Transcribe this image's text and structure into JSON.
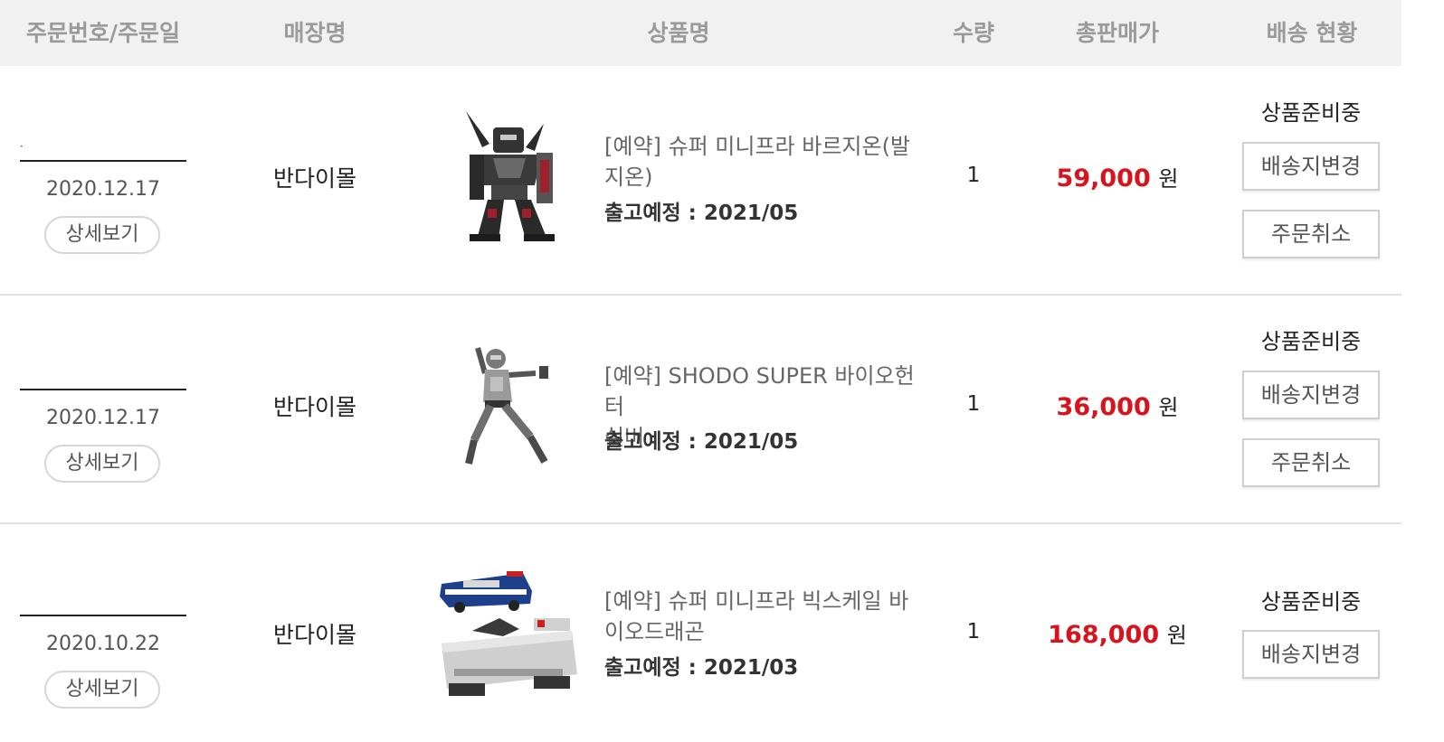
{
  "header": {
    "col_order": "주문번호/주문일",
    "col_store": "매장명",
    "col_product": "상품명",
    "col_qty": "수량",
    "col_total": "총판매가",
    "col_status": "배송 현황"
  },
  "orders": [
    {
      "order_number": "·",
      "date": "2020.12.17",
      "detail_label": "상세보기",
      "store": "반다이몰",
      "product_image": "robot-figure-dark",
      "product_name_line1": "[예약] 슈퍼 미니프라 바르지온(발",
      "product_name_line2": "지온)",
      "release": "출고예정 : 2021/05",
      "qty": "1",
      "price": "59,000",
      "currency": "원",
      "status": "상품준비중",
      "btn_change_address": "배송지변경",
      "btn_cancel": "주문취소"
    },
    {
      "order_number": "",
      "date": "2020.12.17",
      "detail_label": "상세보기",
      "store": "반다이몰",
      "product_image": "hero-figure-silver",
      "product_name_line1": "[예약] SHODO SUPER 바이오헌터",
      "product_name_line2": "실버",
      "release": "출고예정 : 2021/05",
      "qty": "1",
      "price": "36,000",
      "currency": "원",
      "status": "상품준비중",
      "btn_change_address": "배송지변경",
      "btn_cancel": "주문취소"
    },
    {
      "order_number": "",
      "date": "2020.10.22",
      "detail_label": "상세보기",
      "store": "반다이몰",
      "product_image": "vehicle-model-set",
      "product_name_line1": "[예약] 슈퍼 미니프라 빅스케일 바",
      "product_name_line2": "이오드래곤",
      "release": "출고예정 : 2021/03",
      "qty": "1",
      "price": "168,000",
      "currency": "원",
      "status": "상품준비중",
      "btn_change_address": "배송지변경"
    }
  ],
  "colors": {
    "header_bg": "#f1f1f1",
    "header_text": "#9a9a9a",
    "price_red": "#d7141c",
    "divider": "#e1e1e1"
  }
}
